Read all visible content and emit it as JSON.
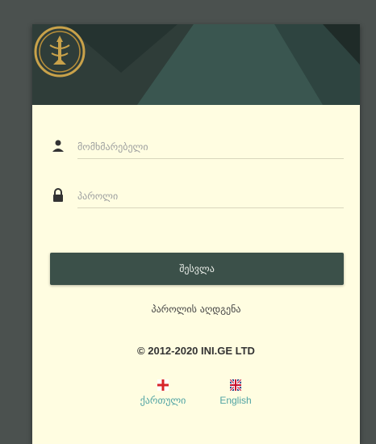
{
  "login": {
    "username_placeholder": "მომხმარებელი",
    "password_placeholder": "პაროლი",
    "submit_label": "შესვლა",
    "forgot_password": "პაროლის აღდგენა"
  },
  "footer": {
    "copyright": "© 2012-2020 INI.GE LTD",
    "languages": [
      {
        "label": "ქართული",
        "flag": "georgia-flag-icon"
      },
      {
        "label": "English",
        "flag": "uk-flag-icon"
      }
    ]
  },
  "colors": {
    "page_background": "#4b514f",
    "card_background": "#fffde1",
    "header_background": "#36504a",
    "button_background": "#3b5049",
    "link_color": "#4fa3a3"
  }
}
